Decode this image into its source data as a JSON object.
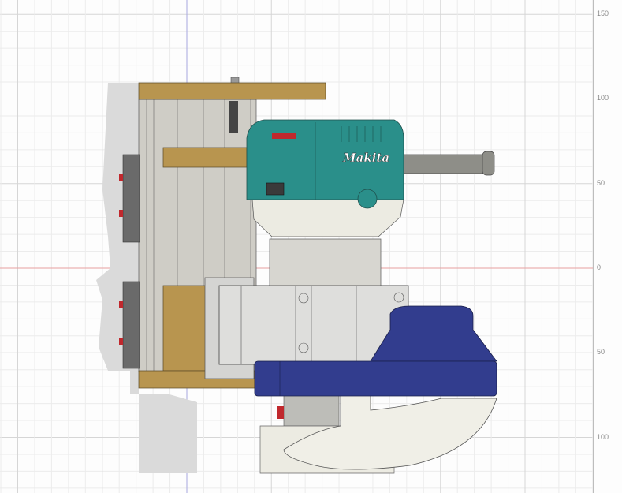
{
  "viewport": {
    "ruler_labels": [
      "150",
      "100",
      "50",
      "0",
      "50",
      "100"
    ],
    "logo_text": "makita",
    "colors": {
      "grid_minor": "#ececec",
      "grid_major": "#d6d6d6",
      "axis_x": "#e8a0a0",
      "axis_y": "#a8a8e0",
      "wood": "#b8954f",
      "teal": "#2a8f8a",
      "blue": "#323d8e",
      "cream": "#ecebe2",
      "steel": "#c9c9c6"
    }
  }
}
